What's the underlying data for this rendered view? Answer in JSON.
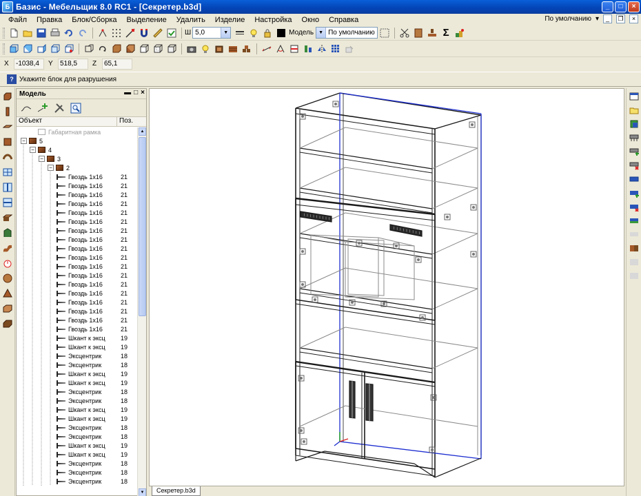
{
  "window": {
    "title": "Базис - Мебельщик 8.0 RC1 - [Секретер.b3d]",
    "controls": [
      "_",
      "□",
      "×"
    ]
  },
  "menu": {
    "items": [
      "Файл",
      "Правка",
      "Блок/Сборка",
      "Выделение",
      "Удалить",
      "Изделие",
      "Настройка",
      "Окно",
      "Справка"
    ],
    "right_label": "По умолчанию"
  },
  "toolbar": {
    "line_width": "5,0",
    "material_label": "Модель",
    "style_combo": "По умолчанию"
  },
  "coords": {
    "x_label": "X",
    "x": "-1038,4",
    "y_label": "Y",
    "y": "518,5",
    "z_label": "Z",
    "z": "65,1"
  },
  "prompt": {
    "text": "Укажите блок для разрушения"
  },
  "model_panel": {
    "title": "Модель",
    "col_object": "Объект",
    "col_pos": "Поз.",
    "tree": [
      {
        "label": "Габаритная рамка",
        "pos": "",
        "level": 1,
        "kind": "frame"
      },
      {
        "label": "5",
        "pos": "",
        "level": 0,
        "kind": "block"
      },
      {
        "label": "4",
        "pos": "",
        "level": 1,
        "kind": "block"
      },
      {
        "label": "3",
        "pos": "",
        "level": 2,
        "kind": "block"
      },
      {
        "label": "2",
        "pos": "",
        "level": 3,
        "kind": "block"
      },
      {
        "label": "Гвоздь 1x16",
        "pos": "21",
        "level": 4,
        "kind": "item"
      },
      {
        "label": "Гвоздь 1x16",
        "pos": "21",
        "level": 4,
        "kind": "item"
      },
      {
        "label": "Гвоздь 1x16",
        "pos": "21",
        "level": 4,
        "kind": "item"
      },
      {
        "label": "Гвоздь 1x16",
        "pos": "21",
        "level": 4,
        "kind": "item"
      },
      {
        "label": "Гвоздь 1x16",
        "pos": "21",
        "level": 4,
        "kind": "item"
      },
      {
        "label": "Гвоздь 1x16",
        "pos": "21",
        "level": 4,
        "kind": "item"
      },
      {
        "label": "Гвоздь 1x16",
        "pos": "21",
        "level": 4,
        "kind": "item"
      },
      {
        "label": "Гвоздь 1x16",
        "pos": "21",
        "level": 4,
        "kind": "item"
      },
      {
        "label": "Гвоздь 1x16",
        "pos": "21",
        "level": 4,
        "kind": "item"
      },
      {
        "label": "Гвоздь 1x16",
        "pos": "21",
        "level": 4,
        "kind": "item"
      },
      {
        "label": "Гвоздь 1x16",
        "pos": "21",
        "level": 4,
        "kind": "item"
      },
      {
        "label": "Гвоздь 1x16",
        "pos": "21",
        "level": 4,
        "kind": "item"
      },
      {
        "label": "Гвоздь 1x16",
        "pos": "21",
        "level": 4,
        "kind": "item"
      },
      {
        "label": "Гвоздь 1x16",
        "pos": "21",
        "level": 4,
        "kind": "item"
      },
      {
        "label": "Гвоздь 1x16",
        "pos": "21",
        "level": 4,
        "kind": "item"
      },
      {
        "label": "Гвоздь 1x16",
        "pos": "21",
        "level": 4,
        "kind": "item"
      },
      {
        "label": "Гвоздь 1x16",
        "pos": "21",
        "level": 4,
        "kind": "item"
      },
      {
        "label": "Гвоздь 1x16",
        "pos": "21",
        "level": 4,
        "kind": "item"
      },
      {
        "label": "Шкант к эксц",
        "pos": "19",
        "level": 4,
        "kind": "item"
      },
      {
        "label": "Шкант к эксц",
        "pos": "19",
        "level": 4,
        "kind": "item"
      },
      {
        "label": "Эксцентрик",
        "pos": "18",
        "level": 4,
        "kind": "item"
      },
      {
        "label": "Эксцентрик",
        "pos": "18",
        "level": 4,
        "kind": "item"
      },
      {
        "label": "Шкант к эксц",
        "pos": "19",
        "level": 4,
        "kind": "item"
      },
      {
        "label": "Шкант к эксц",
        "pos": "19",
        "level": 4,
        "kind": "item"
      },
      {
        "label": "Эксцентрик",
        "pos": "18",
        "level": 4,
        "kind": "item"
      },
      {
        "label": "Эксцентрик",
        "pos": "18",
        "level": 4,
        "kind": "item"
      },
      {
        "label": "Шкант к эксц",
        "pos": "19",
        "level": 4,
        "kind": "item"
      },
      {
        "label": "Шкант к эксц",
        "pos": "19",
        "level": 4,
        "kind": "item"
      },
      {
        "label": "Эксцентрик",
        "pos": "18",
        "level": 4,
        "kind": "item"
      },
      {
        "label": "Эксцентрик",
        "pos": "18",
        "level": 4,
        "kind": "item"
      },
      {
        "label": "Шкант к эксц",
        "pos": "19",
        "level": 4,
        "kind": "item"
      },
      {
        "label": "Шкант к эксц",
        "pos": "19",
        "level": 4,
        "kind": "item"
      },
      {
        "label": "Эксцентрик",
        "pos": "18",
        "level": 4,
        "kind": "item"
      },
      {
        "label": "Эксцентрик",
        "pos": "18",
        "level": 4,
        "kind": "item"
      },
      {
        "label": "Эксцентрик",
        "pos": "18",
        "level": 4,
        "kind": "item"
      }
    ]
  },
  "doc_tab": {
    "label": "Секретер.b3d"
  },
  "colors": {
    "accent_blue": "#0344b6",
    "wire": "#1a1a1a",
    "wire_light": "#8a8a8a",
    "axis_blue": "#1e2fd0"
  }
}
